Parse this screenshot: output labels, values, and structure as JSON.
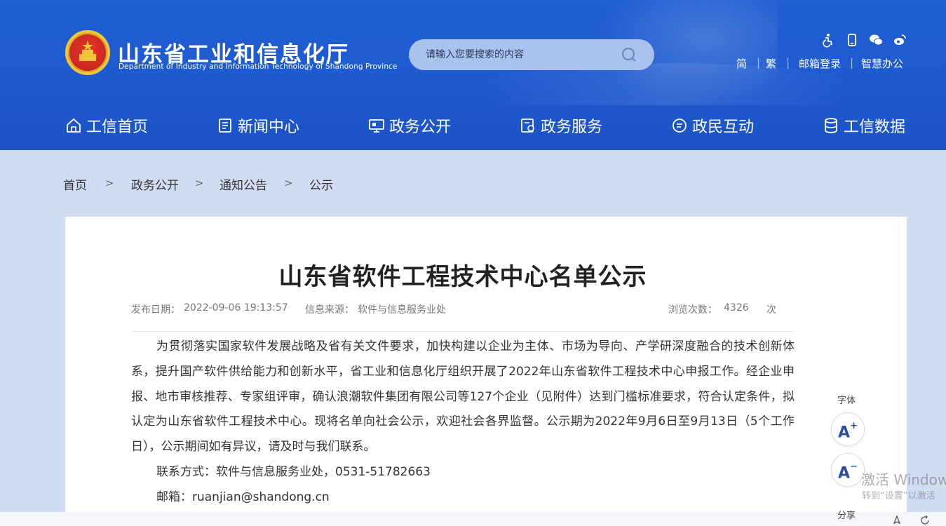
{
  "colors": {
    "header": "#1f5ad0",
    "search_bg": "#a9c2ee",
    "page_bg": "#cfdcf1",
    "content_bg": "#ffffff",
    "accent": "#2a4f9a"
  },
  "header": {
    "title": "山东省工业和信息化厅",
    "subtitle": "Department of Industry and Information Technology of Shandong Province",
    "search_placeholder": "请输入您要搜索的内容",
    "icons": [
      "accessibility-icon",
      "mobile-icon",
      "wechat-icon",
      "weibo-icon"
    ],
    "links": [
      "简",
      "繁",
      "邮箱登录",
      "智慧办公"
    ],
    "separator": "|"
  },
  "nav": [
    {
      "label": "工信首页",
      "icon": "home-icon"
    },
    {
      "label": "新闻中心",
      "icon": "news-icon"
    },
    {
      "label": "政务公开",
      "icon": "screen-icon"
    },
    {
      "label": "政务服务",
      "icon": "service-icon"
    },
    {
      "label": "政民互动",
      "icon": "chat-icon"
    },
    {
      "label": "工信数据",
      "icon": "database-icon"
    }
  ],
  "breadcrumb": {
    "items": [
      "首页",
      "政务公开",
      "通知公告",
      "公示"
    ],
    "separator": ">"
  },
  "article": {
    "title": "山东省软件工程技术中心名单公示",
    "meta": {
      "publish_label": "发布日期：",
      "publish_date": "2022-09-06 19:13:57",
      "source_label": "信息来源：",
      "source": "软件与信息服务业处",
      "views_label": "浏览次数：",
      "views": "4326",
      "views_unit": "次"
    },
    "paragraphs": [
      "为贯彻落实国家软件发展战略及省有关文件要求，加快构建以企业为主体、市场为导向、产学研深度融合的技术创新体系，提升国产软件供给能力和创新水平，省工业和信息化厅组织开展了2022年山东省软件工程技术中心申报工作。经企业申报、地市审核推荐、专家组评审，确认浪潮软件集团有限公司等127个企业（见附件）达到门槛标准要求，符合认定条件，拟认定为山东省软件工程技术中心。现将名单向社会公示，欢迎社会各界监督。公示期为2022年9月6日至9月13日（5个工作日），公示期间如有异议，请及时与我们联系。",
      "联系方式：软件与信息服务业处，0531-51782663",
      "邮箱：ruanjian@shandong.cn"
    ]
  },
  "font_tools": {
    "label": "字体",
    "increase": "A",
    "increase_sup": "+",
    "decrease": "A",
    "decrease_sup": "−",
    "share_label": "分享"
  },
  "watermark": {
    "line1": "激活 Window",
    "line2": "转到“设置”以激活"
  }
}
